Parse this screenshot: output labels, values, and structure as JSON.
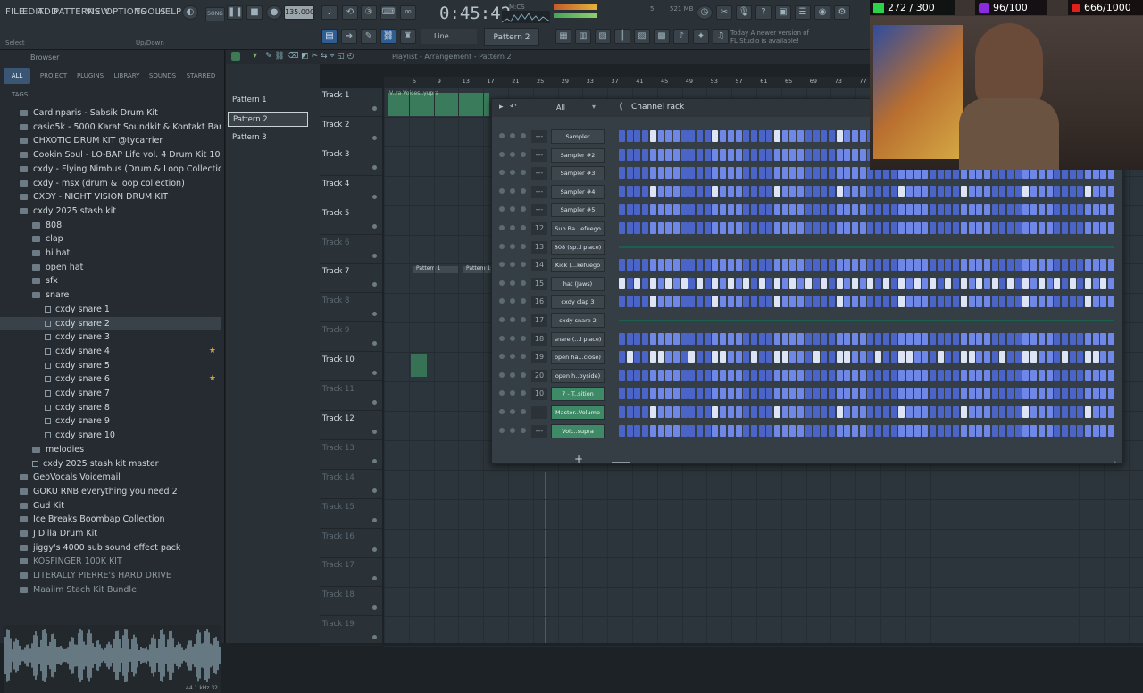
{
  "menu": {
    "file": "FILE",
    "edit": "EDIT",
    "add": "ADD",
    "patterns": "PATTERNS",
    "view": "VIEW",
    "options": "OPTIONS",
    "tools": "TOOLS",
    "help": "HELP"
  },
  "toolbar": {
    "tempo": "135.000",
    "time": "0:45:42",
    "mics": "M:CS",
    "memory": "521 MB",
    "cpu_value": "5",
    "hint_left": "Select",
    "hint_right": "Up/Down",
    "snap": "Line",
    "pattern": "Pattern 2",
    "news_line1": "Today  A newer version of",
    "news_line2": "FL Studio is available!",
    "song_mode": "SONG"
  },
  "browser": {
    "title": "Browser",
    "tabs": [
      "ALL",
      "PROJECT",
      "PLUGINS",
      "LIBRARY",
      "SOUNDS",
      "STARRED"
    ],
    "tags_label": "TAGS",
    "items": [
      {
        "label": "Cardinparis - Sabsik Drum Kit",
        "indent": 1,
        "type": "folder"
      },
      {
        "label": "casio5k - 5000 Karat Soundkit & Kontakt Bank",
        "indent": 1,
        "type": "folder"
      },
      {
        "label": "CHXOTIC DRUM KIT @tycarrier",
        "indent": 1,
        "type": "folder"
      },
      {
        "label": "Cookin Soul - LO-BAP Life vol. 4 Drum Kit 10-2022",
        "indent": 1,
        "type": "folder"
      },
      {
        "label": "cxdy - Flying Nimbus (Drum & Loop Collection)",
        "indent": 1,
        "type": "folder"
      },
      {
        "label": "cxdy - msx (drum & loop collection)",
        "indent": 1,
        "type": "folder"
      },
      {
        "label": "CXDY - NIGHT VISION DRUM KIT",
        "indent": 1,
        "type": "folder"
      },
      {
        "label": "cxdy 2025 stash kit",
        "indent": 1,
        "type": "folder"
      },
      {
        "label": "808",
        "indent": 2,
        "type": "folder"
      },
      {
        "label": "clap",
        "indent": 2,
        "type": "folder"
      },
      {
        "label": "hi hat",
        "indent": 2,
        "type": "folder"
      },
      {
        "label": "open hat",
        "indent": 2,
        "type": "folder"
      },
      {
        "label": "sfx",
        "indent": 2,
        "type": "folder"
      },
      {
        "label": "snare",
        "indent": 2,
        "type": "folder"
      },
      {
        "label": "cxdy snare 1",
        "indent": 3,
        "type": "file"
      },
      {
        "label": "cxdy snare 2",
        "indent": 3,
        "type": "file",
        "selected": true
      },
      {
        "label": "cxdy snare 3",
        "indent": 3,
        "type": "file"
      },
      {
        "label": "cxdy snare 4",
        "indent": 3,
        "type": "file",
        "star": true
      },
      {
        "label": "cxdy snare 5",
        "indent": 3,
        "type": "file"
      },
      {
        "label": "cxdy snare 6",
        "indent": 3,
        "type": "file",
        "star": true
      },
      {
        "label": "cxdy snare 7",
        "indent": 3,
        "type": "file"
      },
      {
        "label": "cxdy snare 8",
        "indent": 3,
        "type": "file"
      },
      {
        "label": "cxdy snare 9",
        "indent": 3,
        "type": "file"
      },
      {
        "label": "cxdy snare 10",
        "indent": 3,
        "type": "file"
      },
      {
        "label": "melodies",
        "indent": 2,
        "type": "folder"
      },
      {
        "label": "cxdy 2025 stash kit master",
        "indent": 2,
        "type": "file"
      },
      {
        "label": "GeoVocals Voicemail",
        "indent": 1,
        "type": "folder"
      },
      {
        "label": "GOKU RNB  everything you need 2",
        "indent": 1,
        "type": "folder"
      },
      {
        "label": "Gud Kit",
        "indent": 1,
        "type": "folder"
      },
      {
        "label": "Ice Breaks Boombap Collection",
        "indent": 1,
        "type": "folder"
      },
      {
        "label": "J Dilla Drum Kit",
        "indent": 1,
        "type": "folder"
      },
      {
        "label": "jiggy's 4000 sub sound effect pack",
        "indent": 1,
        "type": "folder"
      },
      {
        "label": "KOSFINGER 100K KIT",
        "indent": 1,
        "type": "folder"
      },
      {
        "label": "LITERALLY PIERRE's HARD DRIVE",
        "indent": 1,
        "type": "folder"
      },
      {
        "label": "Maaiim Stach Kit Bundle",
        "indent": 1,
        "type": "folder"
      }
    ],
    "sample_info": "44.1 kHz 32"
  },
  "playlist": {
    "title": "Playlist - Arrangement - Pattern 2",
    "patterns": [
      "Pattern 1",
      "Pattern 2",
      "Pattern 3"
    ],
    "ruler": [
      "5",
      "9",
      "13",
      "17",
      "21",
      "25",
      "29",
      "33",
      "37",
      "41",
      "45",
      "49",
      "53",
      "57",
      "61",
      "65",
      "69",
      "73",
      "77"
    ],
    "tracks": [
      "Track 1",
      "Track 2",
      "Track 3",
      "Track 4",
      "Track 5",
      "Track 6",
      "Track 7",
      "Track 8",
      "Track 9",
      "Track 10",
      "Track 11",
      "Track 12",
      "Track 13",
      "Track 14",
      "Track 15",
      "Track 16",
      "Track 17",
      "Track 18",
      "Track 19"
    ],
    "clip_voices": "V..ra Voices..yupra",
    "clip_pattern1": "Pattern 1",
    "clip_pattern2": "Pattern 1"
  },
  "channel_rack": {
    "title": "Channel rack",
    "filter": "All",
    "channels": [
      {
        "num": "---",
        "name": "Sampler",
        "type": "steps"
      },
      {
        "num": "---",
        "name": "Sampler #2",
        "type": "steps"
      },
      {
        "num": "---",
        "name": "Sampler #3",
        "type": "steps"
      },
      {
        "num": "---",
        "name": "Sampler #4",
        "type": "steps"
      },
      {
        "num": "---",
        "name": "Sampler #5",
        "type": "steps"
      },
      {
        "num": "12",
        "name": "Sub Ba...efuego",
        "type": "steps"
      },
      {
        "num": "13",
        "name": "808 (sp..l place)",
        "type": "seq"
      },
      {
        "num": "14",
        "name": "Kick (...kefuego",
        "type": "steps"
      },
      {
        "num": "15",
        "name": "hat (Jaws)",
        "type": "steps"
      },
      {
        "num": "16",
        "name": "cxdy clap 3",
        "type": "steps"
      },
      {
        "num": "17",
        "name": "cxdy snare 2",
        "type": "seq"
      },
      {
        "num": "18",
        "name": "snare (...l place)",
        "type": "steps"
      },
      {
        "num": "19",
        "name": "open ha...close)",
        "type": "steps"
      },
      {
        "num": "20",
        "name": "open h..byside)",
        "type": "steps"
      },
      {
        "num": "10",
        "name": "7 - T..sition",
        "type": "steps",
        "green": true
      },
      {
        "num": "",
        "name": "Master..Volume",
        "type": "steps",
        "green": true
      },
      {
        "num": "---",
        "name": "Voic..supra",
        "type": "steps",
        "green": true
      }
    ],
    "add_label": "+"
  },
  "stream": {
    "counter1": "272 / 300",
    "counter2": "96/100",
    "counter3": "666/1000",
    "counter1_color": "#2bd24a",
    "counter2_color": "#8a2be2",
    "counter3_color": "#e0201b"
  },
  "colors": {
    "accent_blue": "#4a64c8",
    "active_step": "#dde4f5",
    "green_channel": "#3e8a66"
  }
}
